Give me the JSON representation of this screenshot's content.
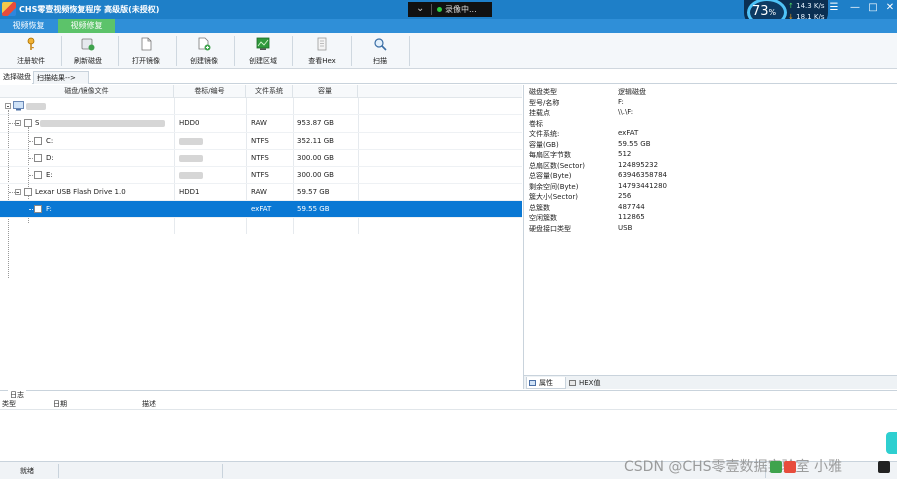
{
  "titlebar": {
    "title": "CHS零壹视频恢复程序 高级版(未授权)",
    "recording_label": "录像中...",
    "gauge_value": "73",
    "gauge_unit": "%",
    "upload_speed": "14.3 K/s",
    "download_speed": "18.1 K/s"
  },
  "tabs": [
    "视频恢复",
    "视频修复"
  ],
  "toolbar": [
    {
      "label": "注册软件",
      "icon": "key-icon"
    },
    {
      "label": "刷新磁盘",
      "icon": "refresh-disk-icon"
    },
    {
      "label": "打开镜像",
      "icon": "open-image-icon"
    },
    {
      "label": "创建镜像",
      "icon": "create-image-icon"
    },
    {
      "label": "创建区域",
      "icon": "create-region-icon"
    },
    {
      "label": "查看Hex",
      "icon": "hex-view-icon"
    },
    {
      "label": "扫描",
      "icon": "scan-icon"
    }
  ],
  "subtabs": [
    "选择磁盘",
    "扫描结果-->"
  ],
  "disk_table": {
    "headers": [
      "磁盘/镜像文件",
      "卷标/编号",
      "文件系统",
      "容量"
    ],
    "rows": [
      {
        "name": "S",
        "label": "HDD0",
        "fs": "RAW",
        "size": "953.87 GB"
      },
      {
        "name": "C:",
        "label": "",
        "fs": "NTFS",
        "size": "352.11 GB"
      },
      {
        "name": "D:",
        "label": "",
        "fs": "NTFS",
        "size": "300.00 GB"
      },
      {
        "name": "E:",
        "label": "",
        "fs": "NTFS",
        "size": "300.00 GB"
      },
      {
        "name": "Lexar   USB Flash Drive 1.0",
        "label": "HDD1",
        "fs": "RAW",
        "size": "59.57 GB"
      },
      {
        "name": "F:",
        "label": "",
        "fs": "exFAT",
        "size": "59.55 GB"
      }
    ]
  },
  "properties": {
    "header_key": "磁盘类型",
    "header_value": "逻辑磁盘",
    "rows": [
      {
        "k": "型号/名称",
        "v": "F:"
      },
      {
        "k": "挂载点",
        "v": "\\\\.\\F:"
      },
      {
        "k": "卷标",
        "v": ""
      },
      {
        "k": "文件系统:",
        "v": "exFAT"
      },
      {
        "k": "容量(GB)",
        "v": "59.55 GB"
      },
      {
        "k": "每扇区字节数",
        "v": "512"
      },
      {
        "k": "总扇区数(Sector)",
        "v": "124895232"
      },
      {
        "k": "总容量(Byte)",
        "v": "63946358784"
      },
      {
        "k": "剩余空间(Byte)",
        "v": "14793441280"
      },
      {
        "k": "簇大小(Sector)",
        "v": "256"
      },
      {
        "k": "总簇数",
        "v": "487744"
      },
      {
        "k": "空闲簇数",
        "v": "112865"
      },
      {
        "k": "硬盘接口类型",
        "v": "USB"
      }
    ],
    "tabs": [
      "属性",
      "HEX值"
    ]
  },
  "log": {
    "title": "日志",
    "headers": [
      "类型",
      "日期",
      "描述"
    ]
  },
  "status": {
    "text": "就绪"
  },
  "watermark": "CSDN @CHS零壹数据实验室 小雅"
}
